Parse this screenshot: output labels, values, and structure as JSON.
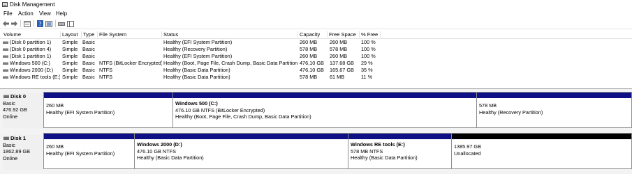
{
  "window": {
    "title": "Disk Management"
  },
  "menu": [
    "File",
    "Action",
    "View",
    "Help"
  ],
  "toolbar": {
    "icons": [
      "back-arrow-icon",
      "forward-arrow-icon",
      "properties-icon",
      "help-icon",
      "console-icon",
      "settings-icon",
      "view-icon"
    ]
  },
  "volumes": {
    "columns": [
      "Volume",
      "Layout",
      "Type",
      "File System",
      "Status",
      "Capacity",
      "Free Space",
      "% Free"
    ],
    "rows": [
      {
        "volume": "(Disk 0 partition 1)",
        "layout": "Simple",
        "type": "Basic",
        "fs": "",
        "status": "Healthy (EFI System Partition)",
        "capacity": "260 MB",
        "free": "260 MB",
        "pct": "100 %"
      },
      {
        "volume": "(Disk 0 partition 4)",
        "layout": "Simple",
        "type": "Basic",
        "fs": "",
        "status": "Healthy (Recovery Partition)",
        "capacity": "578 MB",
        "free": "578 MB",
        "pct": "100 %"
      },
      {
        "volume": "(Disk 1 partition 1)",
        "layout": "Simple",
        "type": "Basic",
        "fs": "",
        "status": "Healthy (EFI System Partition)",
        "capacity": "260 MB",
        "free": "260 MB",
        "pct": "100 %"
      },
      {
        "volume": "Windows 500 (C:)",
        "layout": "Simple",
        "type": "Basic",
        "fs": "NTFS (BitLocker Encrypted)",
        "status": "Healthy (Boot, Page File, Crash Dump, Basic Data Partition)",
        "capacity": "476.10 GB",
        "free": "137.68 GB",
        "pct": "29 %"
      },
      {
        "volume": "Windows 2000 (D:)",
        "layout": "Simple",
        "type": "Basic",
        "fs": "NTFS",
        "status": "Healthy (Basic Data Partition)",
        "capacity": "476.10 GB",
        "free": "165.67 GB",
        "pct": "35 %"
      },
      {
        "volume": "Windows RE tools (E:)",
        "layout": "Simple",
        "type": "Basic",
        "fs": "NTFS",
        "status": "Healthy (Basic Data Partition)",
        "capacity": "578 MB",
        "free": "61 MB",
        "pct": "11 %"
      }
    ]
  },
  "disks": [
    {
      "name": "Disk 0",
      "type": "Basic",
      "size": "476.92 GB",
      "status": "Online",
      "partitions": [
        {
          "name": "",
          "line1": "260 MB",
          "line2": "Healthy (EFI System Partition)",
          "unallocated": false
        },
        {
          "name": "Windows 500  (C:)",
          "line1": "476.10 GB NTFS (BitLocker Encrypted)",
          "line2": "Healthy (Boot, Page File, Crash Dump, Basic Data Partition)",
          "unallocated": false
        },
        {
          "name": "",
          "line1": "578 MB",
          "line2": "Healthy (Recovery Partition)",
          "unallocated": false
        }
      ]
    },
    {
      "name": "Disk 1",
      "type": "Basic",
      "size": "1862.89 GB",
      "status": "Online",
      "partitions": [
        {
          "name": "",
          "line1": "260 MB",
          "line2": "Healthy (EFI System Partition)",
          "unallocated": false
        },
        {
          "name": "Windows 2000  (D:)",
          "line1": "476.10 GB NTFS",
          "line2": "Healthy (Basic Data Partition)",
          "unallocated": false
        },
        {
          "name": "Windows RE tools  (E:)",
          "line1": "578 MB NTFS",
          "line2": "Healthy (Basic Data Partition)",
          "unallocated": false
        },
        {
          "name": "",
          "line1": "1385.97 GB",
          "line2": "Unallocated",
          "unallocated": true
        }
      ]
    }
  ],
  "colors": {
    "primary_partition": "#0f0f86",
    "unallocated": "#000000",
    "border": "#8c8c8c"
  }
}
